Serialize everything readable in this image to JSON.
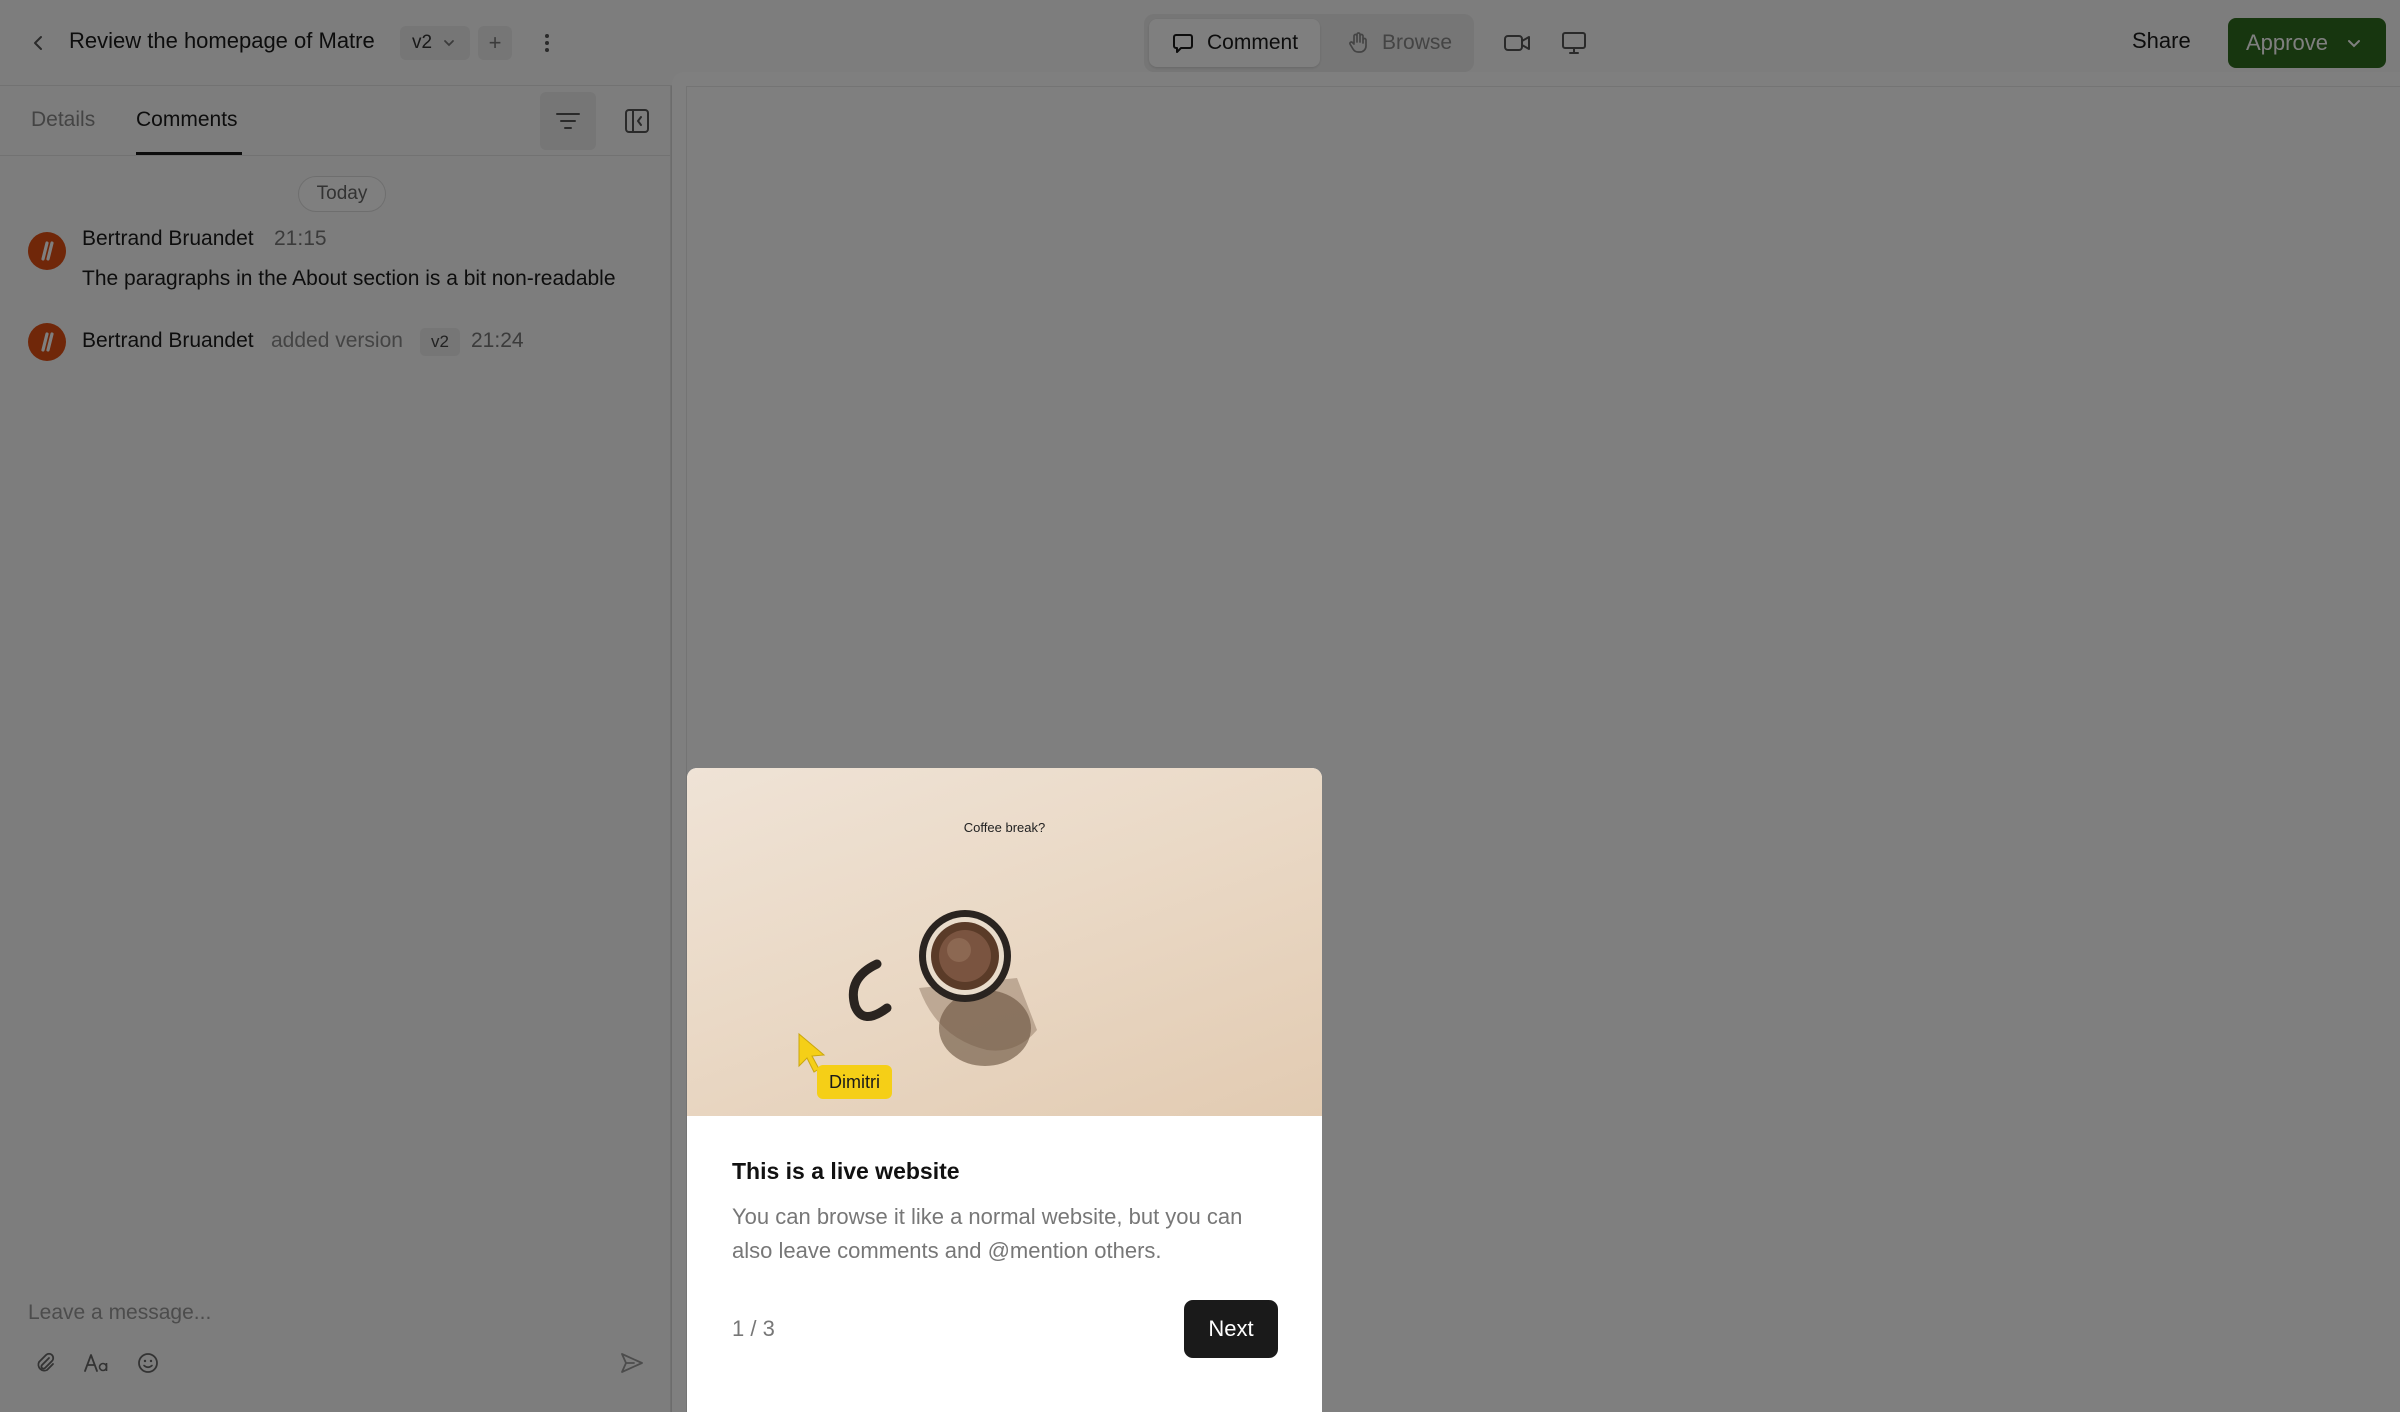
{
  "header": {
    "title": "Review the homepage of Matre",
    "version_label": "v2",
    "add_label": "+",
    "modes": [
      {
        "label": "Comment",
        "active": true
      },
      {
        "label": "Browse",
        "active": false
      }
    ],
    "share_label": "Share",
    "approve_label": "Approve"
  },
  "sidebar": {
    "tabs": [
      {
        "label": "Details",
        "active": false
      },
      {
        "label": "Comments",
        "active": true
      }
    ],
    "day_label": "Today",
    "comments": [
      {
        "author": "Bertrand Bruandet",
        "time": "21:15",
        "text": "The paragraphs in the About section is a bit non-readable"
      },
      {
        "author": "Bertrand Bruandet",
        "action": "added version",
        "version": "v2",
        "time": "21:24"
      }
    ],
    "composer_placeholder": "Leave a message..."
  },
  "onboarding": {
    "hero_caption": "Coffee break?",
    "cursor_name": "Dimitri",
    "title": "This is a live website",
    "body": "You can browse it like a normal website, but you can also leave comments and @mention others.",
    "step": "1 / 3",
    "next_label": "Next"
  },
  "colors": {
    "approve_green": "#2f6d1e",
    "avatar_orange": "#e04e12",
    "cursor_yellow": "#f5cf17"
  }
}
